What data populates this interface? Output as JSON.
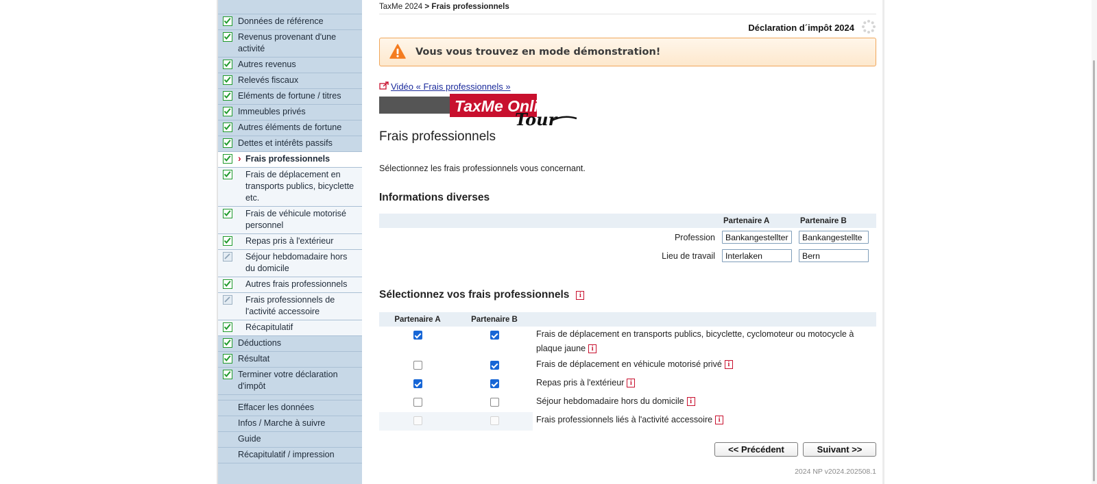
{
  "sidebar": {
    "items": [
      {
        "label": "Données de référence",
        "status": "done",
        "level": "top"
      },
      {
        "label": "Revenus provenant d'une activité",
        "status": "done",
        "level": "top"
      },
      {
        "label": "Autres revenus",
        "status": "done",
        "level": "top"
      },
      {
        "label": "Relevés fiscaux",
        "status": "done",
        "level": "top"
      },
      {
        "label": "Eléments de fortune / titres",
        "status": "done",
        "level": "top"
      },
      {
        "label": "Immeubles privés",
        "status": "done",
        "level": "top"
      },
      {
        "label": "Autres éléments de fortune",
        "status": "done",
        "level": "top"
      },
      {
        "label": "Dettes et intérêts passifs",
        "status": "done",
        "level": "top"
      },
      {
        "label": "Frais professionnels",
        "status": "done",
        "level": "active"
      },
      {
        "label": "Frais de déplacement en transports publics, bicyclette etc.",
        "status": "done",
        "level": "sub"
      },
      {
        "label": "Frais de véhicule motorisé personnel",
        "status": "done",
        "level": "sub"
      },
      {
        "label": "Repas pris à l'extérieur",
        "status": "done",
        "level": "sub"
      },
      {
        "label": "Séjour hebdomadaire hors du domicile",
        "status": "na",
        "level": "sub"
      },
      {
        "label": "Autres frais professionnels",
        "status": "done",
        "level": "sub"
      },
      {
        "label": "Frais professionnels de l'activité accessoire",
        "status": "na",
        "level": "sub"
      },
      {
        "label": "Récapitulatif",
        "status": "done",
        "level": "sub"
      },
      {
        "label": "Déductions",
        "status": "done",
        "level": "top"
      },
      {
        "label": "Résultat",
        "status": "done",
        "level": "top"
      },
      {
        "label": "Terminer votre déclaration d'impôt",
        "status": "done",
        "level": "top"
      }
    ],
    "utility": [
      {
        "label": "Effacer les données"
      },
      {
        "label": "Infos / Marche à suivre"
      },
      {
        "label": "Guide"
      },
      {
        "label": "Récapitulatif / impression"
      }
    ]
  },
  "breadcrumb": {
    "root": "TaxMe 2024",
    "separator": " > ",
    "current": "Frais professionnels"
  },
  "header": {
    "title": "Déclaration d´impôt 2024"
  },
  "banner": {
    "text": "Vous vous trouvez en mode démonstration!",
    "color": "#f47c20"
  },
  "video_link": "Vidéo « Frais professionnels »",
  "tour_logo": {
    "brand": "TaxMe Online",
    "tag": "Tour"
  },
  "page_title": "Frais professionnels",
  "intro": "Sélectionnez les frais professionnels vous concernant.",
  "info_section": {
    "title": "Informations diverses",
    "col_a": "Partenaire A",
    "col_b": "Partenaire B",
    "rows": [
      {
        "label": "Profession",
        "a": "Bankangestellter",
        "b": "Bankangestellte"
      },
      {
        "label": "Lieu de travail",
        "a": "Interlaken",
        "b": "Bern"
      }
    ]
  },
  "select_section": {
    "title": "Sélectionnez vos frais professionnels",
    "col_a": "Partenaire A",
    "col_b": "Partenaire B",
    "rows": [
      {
        "label": "Frais de déplacement en transports publics, bicyclette, cyclomoteur ou motocycle à plaque jaune",
        "a": true,
        "b": true,
        "disabled": false
      },
      {
        "label": "Frais de déplacement en véhicule motorisé privé",
        "a": false,
        "b": true,
        "disabled": false
      },
      {
        "label": "Repas pris à l'extérieur",
        "a": true,
        "b": true,
        "disabled": false
      },
      {
        "label": "Séjour hebdomadaire hors du domicile",
        "a": false,
        "b": false,
        "disabled": false
      },
      {
        "label": "Frais professionnels liés à l'activité accessoire",
        "a": false,
        "b": false,
        "disabled": true
      }
    ]
  },
  "buttons": {
    "prev": "<< Précédent",
    "next": "Suivant >>"
  },
  "version": "2024 NP v2024.202508.1",
  "colors": {
    "sidebar_bg": "#c7d8e7",
    "check_green": "#1f9a2b",
    "info_red": "#c8102e",
    "checkbox_blue": "#1766d6"
  }
}
